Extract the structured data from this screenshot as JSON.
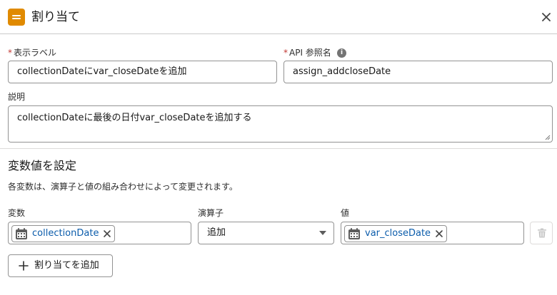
{
  "header": {
    "title": "割り当て"
  },
  "form": {
    "label_field": {
      "required_mark": "*",
      "label": "表示ラベル",
      "value": "collectionDateにvar_closeDateを追加"
    },
    "api_field": {
      "required_mark": "*",
      "label": "API 参照名",
      "info_glyph": "i",
      "value": "assign_addcloseDate"
    },
    "description": {
      "label": "説明",
      "value": "collectionDateに最後の日付var_closeDateを追加する"
    }
  },
  "section": {
    "title": "変数値を設定",
    "description": "各変数は、演算子と値の組み合わせによって変更されます。"
  },
  "assignment": {
    "columns": {
      "variable": "変数",
      "operator": "演算子",
      "value": "値"
    },
    "row": {
      "variable": "collectionDate",
      "operator": "追加",
      "value": "var_closeDate"
    }
  },
  "actions": {
    "add_label": "割り当てを追加"
  },
  "icons": {
    "header": "assignment-icon",
    "close": "close-icon",
    "info": "info-icon",
    "variable_resource": "calendar-icon",
    "remove": "remove-icon",
    "dropdown": "chevron-down-icon",
    "delete": "trash-icon",
    "add": "plus-icon"
  },
  "colors": {
    "accent_orange": "#e08a00",
    "link_blue": "#0b5cab",
    "required_red": "#c23934"
  }
}
